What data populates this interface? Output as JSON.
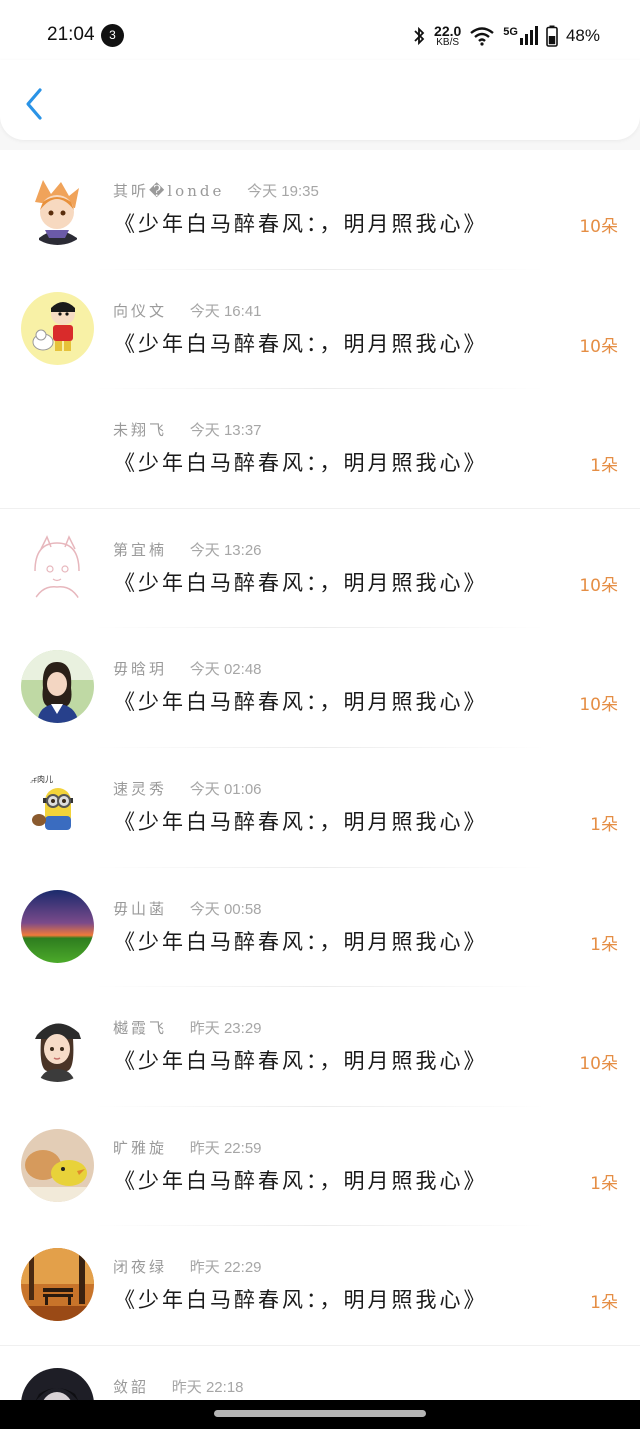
{
  "status_bar": {
    "time": "21:04",
    "notification_count": "3",
    "speed_value": "22.0",
    "speed_unit": "KB/S",
    "network": "5G",
    "battery": "48%"
  },
  "header": {
    "back_icon": "chevron-left-icon"
  },
  "accent_color": "#e58e45",
  "list": [
    {
      "name": "其听�londe",
      "time": "今天 19:35",
      "title": "《少年白马醉春风：，明月照我心》",
      "count": "10朵",
      "avatar": "anime-fox-girl"
    },
    {
      "name": "向仪文",
      "time": "今天 16:41",
      "title": "《少年白马醉春风：，明月照我心》",
      "count": "10朵",
      "avatar": "crayon-shin-chan"
    },
    {
      "name": "未翔飞",
      "time": "今天 13:37",
      "title": "《少年白马醉春风：，明月照我心》",
      "count": "1朵",
      "avatar": "blank"
    },
    {
      "name": "第宜楠",
      "time": "今天 13:26",
      "title": "《少年白马醉春风：，明月照我心》",
      "count": "10朵",
      "avatar": "sketch-anime-girl"
    },
    {
      "name": "毋晗玥",
      "time": "今天 02:48",
      "title": "《少年白马醉春风：，明月照我心》",
      "count": "10朵",
      "avatar": "girl-photo"
    },
    {
      "name": "速灵秀",
      "time": "今天 01:06",
      "title": "《少年白马醉春风：，明月照我心》",
      "count": "1朵",
      "avatar": "minion"
    },
    {
      "name": "毋山菡",
      "time": "今天 00:58",
      "title": "《少年白马醉春风：，明月照我心》",
      "count": "1朵",
      "avatar": "sunset-field"
    },
    {
      "name": "樾霞飞",
      "time": "昨天 23:29",
      "title": "《少年白马醉春风：，明月照我心》",
      "count": "10朵",
      "avatar": "cartoon-girl-cap"
    },
    {
      "name": "旷雅旋",
      "time": "昨天 22:59",
      "title": "《少年白马醉春风：，明月照我心》",
      "count": "1朵",
      "avatar": "yellow-chick"
    },
    {
      "name": "闭夜绿",
      "time": "昨天 22:29",
      "title": "《少年白马醉春风：，明月照我心》",
      "count": "1朵",
      "avatar": "autumn-bench"
    },
    {
      "name": "敛韶",
      "time": "昨天 22:18",
      "title": "",
      "count": "",
      "avatar": "dark-anime-girl"
    }
  ]
}
